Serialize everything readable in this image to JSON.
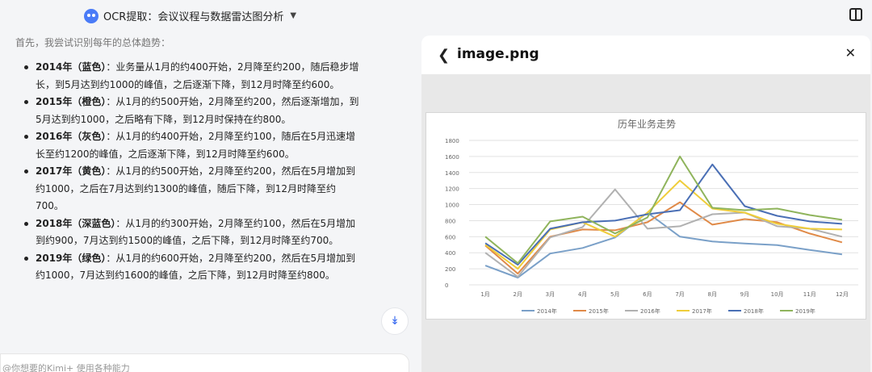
{
  "header": {
    "title": "OCR提取：会议议程与数据雷达图分析"
  },
  "chat": {
    "intro": "首先，我尝试识别每年的总体趋势：",
    "items": [
      {
        "label": "2014年（蓝色）",
        "text": "：业务量从1月的约400开始，2月降至约200，随后稳步增长，到5月达到约1000的峰值，之后逐渐下降，到12月时降至约600。"
      },
      {
        "label": "2015年（橙色）",
        "text": "：从1月的约500开始，2月降至约200，然后逐渐增加，到5月达到约1000，之后略有下降，到12月时保持在约800。"
      },
      {
        "label": "2016年（灰色）",
        "text": "：从1月的约400开始，2月降至约100，随后在5月迅速增长至约1200的峰值，之后逐渐下降，到12月时降至约600。"
      },
      {
        "label": "2017年（黄色）",
        "text": "：从1月的约500开始，2月降至约200，然后在5月增加到约1000，之后在7月达到约1300的峰值，随后下降，到12月时降至约700。"
      },
      {
        "label": "2018年（深蓝色）",
        "text": "：从1月的约300开始，2月降至约100，然后在5月增加到约900，7月达到约1500的峰值，之后下降，到12月时降至约700。"
      },
      {
        "label": "2019年（绿色）",
        "text": "：从1月的约600开始，2月降至约200，然后在5月增加到约1000，7月达到约1600的峰值，之后下降，到12月时降至约800。"
      }
    ],
    "input_placeholder": "@你想要的Kimi+ 使用各种能力"
  },
  "panel": {
    "title": "image.png"
  },
  "chart_data": {
    "type": "line",
    "title": "历年业务走势",
    "categories": [
      "1月",
      "2月",
      "3月",
      "4月",
      "5月",
      "6月",
      "7月",
      "8月",
      "9月",
      "10月",
      "11月",
      "12月"
    ],
    "ylim": [
      0,
      1800
    ],
    "yticks": [
      0,
      200,
      400,
      600,
      800,
      1000,
      1200,
      1400,
      1600,
      1800
    ],
    "grid": true,
    "legend": "bottom",
    "series": [
      {
        "name": "2014年",
        "color": "#7aa0c8",
        "values": [
          240,
          90,
          390,
          460,
          590,
          900,
          600,
          540,
          515,
          495,
          435,
          380
        ]
      },
      {
        "name": "2015年",
        "color": "#e08a48",
        "values": [
          490,
          140,
          600,
          690,
          680,
          780,
          1030,
          750,
          820,
          780,
          640,
          530
        ]
      },
      {
        "name": "2016年",
        "color": "#b1b1b1",
        "values": [
          400,
          100,
          590,
          720,
          1190,
          700,
          730,
          880,
          900,
          730,
          700,
          600
        ]
      },
      {
        "name": "2017年",
        "color": "#efcd3a",
        "values": [
          500,
          200,
          690,
          780,
          600,
          900,
          1300,
          950,
          900,
          760,
          700,
          690
        ]
      },
      {
        "name": "2018年",
        "color": "#4a6fb5",
        "values": [
          520,
          250,
          700,
          780,
          800,
          880,
          930,
          1500,
          980,
          860,
          790,
          760
        ]
      },
      {
        "name": "2019年",
        "color": "#8fb45c",
        "values": [
          600,
          270,
          790,
          850,
          640,
          840,
          1600,
          960,
          930,
          950,
          870,
          810
        ]
      }
    ]
  }
}
